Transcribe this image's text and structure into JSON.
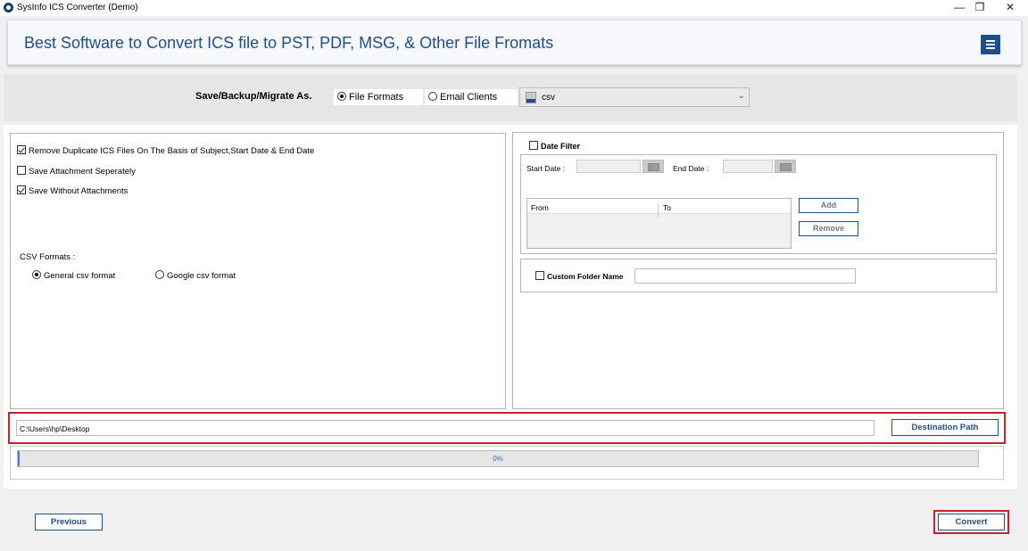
{
  "window": {
    "title": "SysInfo ICS Converter (Demo)",
    "controls": {
      "minimize": "—",
      "restore": "❐",
      "close": "✕"
    }
  },
  "header": {
    "title": "Best Software to Convert ICS file to PST, PDF, MSG, & Other File Fromats",
    "menu_icon": "hamburger-icon"
  },
  "save_as": {
    "label": "Save/Backup/Migrate As.",
    "options": [
      "File Formats",
      "Email Clients"
    ],
    "selected": "File Formats",
    "format_value": "csv",
    "format_icon": "csv-file-icon"
  },
  "options": {
    "remove_duplicates": {
      "label": "Remove Duplicate ICS Files On The Basis of Subject,Start Date & End Date",
      "checked": true
    },
    "save_attachment_separately": {
      "label": "Save Attachment Seperately",
      "checked": false
    },
    "save_without_attachments": {
      "label": "Save Without Attachments",
      "checked": true
    },
    "csv_formats_label": "CSV Formats :",
    "csv_formats": [
      "General csv format",
      "Google csv format"
    ],
    "csv_selected": "General csv format"
  },
  "date_filter": {
    "label": "Date Filter",
    "checked": false,
    "start_label": "Start Date :",
    "end_label": "End Date :",
    "table_headers": [
      "From",
      "To"
    ],
    "add_label": "Add",
    "remove_label": "Remove"
  },
  "custom_folder": {
    "label": "Custom Folder Name",
    "checked": false,
    "value": ""
  },
  "destination": {
    "path": "C:\\Users\\hp\\Desktop",
    "button_label": "Destination Path"
  },
  "progress": {
    "percent": 0,
    "text": "0%"
  },
  "footer": {
    "previous_label": "Previous",
    "convert_label": "Convert"
  },
  "colors": {
    "accent": "#1f4e8c",
    "highlight": "#c8232c"
  }
}
